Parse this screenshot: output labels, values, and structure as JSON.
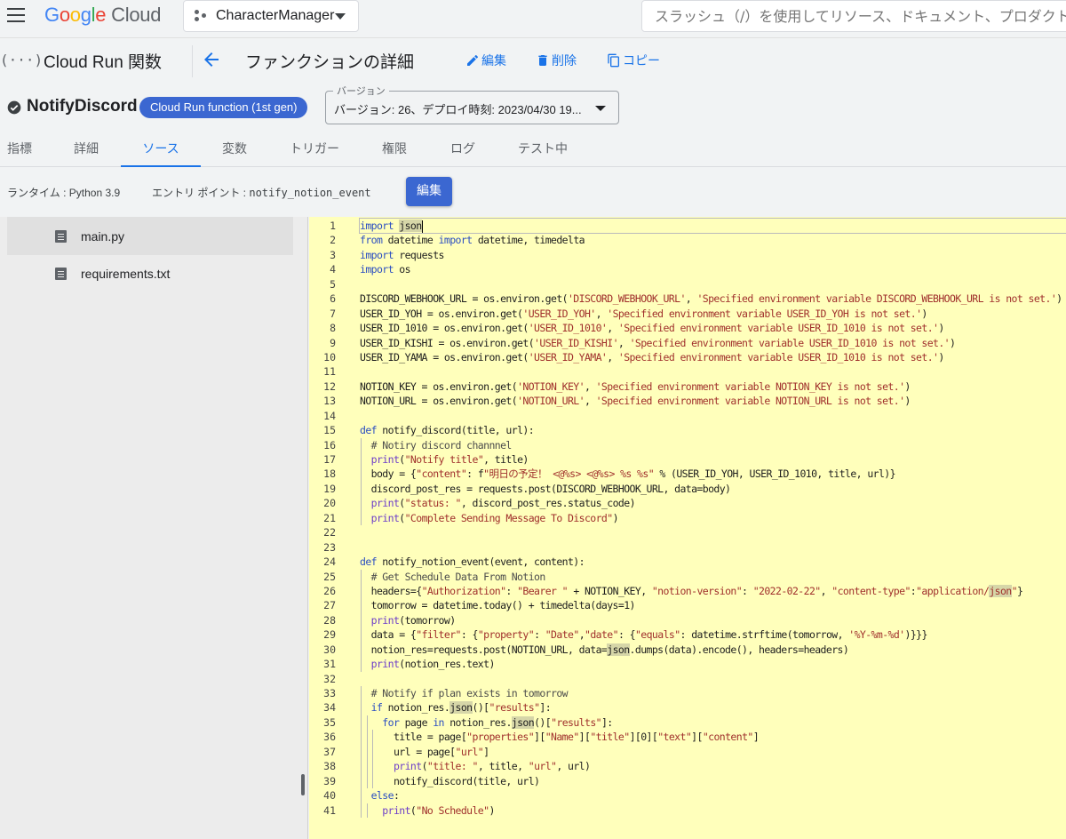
{
  "topbar": {
    "logo_letters": [
      "G",
      "o",
      "o",
      "g",
      "l",
      "e"
    ],
    "logo_suffix": "Cloud",
    "project_name": "CharacterManager",
    "search_placeholder": "スラッシュ（/）を使用してリソース、ドキュメント、プロダクトな"
  },
  "header": {
    "service_icon_text": "(···)",
    "service_name": "Cloud Run 関数",
    "page_title": "ファンクションの詳細",
    "actions": {
      "edit": "編集",
      "delete": "削除",
      "copy": "コピー"
    }
  },
  "function": {
    "name": "NotifyDiscord",
    "generation_badge": "Cloud Run function (1st gen)",
    "version_legend": "バージョン",
    "version_value": "バージョン: 26、デプロイ時刻: 2023/04/30 19..."
  },
  "tabs": [
    {
      "label": "指標"
    },
    {
      "label": "詳細"
    },
    {
      "label": "ソース",
      "active": true
    },
    {
      "label": "変数"
    },
    {
      "label": "トリガー"
    },
    {
      "label": "権限"
    },
    {
      "label": "ログ"
    },
    {
      "label": "テスト中"
    }
  ],
  "source": {
    "runtime_label": "ランタイム : Python 3.9",
    "entry_prefix": "エントリ ポイント : ",
    "entry_point": "notify_notion_event",
    "edit_button": "編集"
  },
  "files": [
    {
      "name": "main.py",
      "selected": true
    },
    {
      "name": "requirements.txt",
      "selected": false
    }
  ],
  "code_lines": [
    "import json",
    "from datetime import datetime, timedelta",
    "import requests",
    "import os",
    "",
    "DISCORD_WEBHOOK_URL = os.environ.get('DISCORD_WEBHOOK_URL', 'Specified environment variable DISCORD_WEBHOOK_URL is not set.')",
    "USER_ID_YOH = os.environ.get('USER_ID_YOH', 'Specified environment variable USER_ID_YOH is not set.')",
    "USER_ID_1010 = os.environ.get('USER_ID_1010', 'Specified environment variable USER_ID_1010 is not set.')",
    "USER_ID_KISHI = os.environ.get('USER_ID_KISHI', 'Specified environment variable USER_ID_1010 is not set.')",
    "USER_ID_YAMA = os.environ.get('USER_ID_YAMA', 'Specified environment variable USER_ID_1010 is not set.')",
    "",
    "NOTION_KEY = os.environ.get('NOTION_KEY', 'Specified environment variable NOTION_KEY is not set.')",
    "NOTION_URL = os.environ.get('NOTION_URL', 'Specified environment variable NOTION_URL is not set.')",
    "",
    "def notify_discord(title, url):",
    "  # Notiry discord channnel",
    "  print(\"Notify title\", title)",
    "  body = {\"content\": f\"明日の予定！ <@%s> <@%s> %s %s\" % (USER_ID_YOH, USER_ID_1010, title, url)}",
    "  discord_post_res = requests.post(DISCORD_WEBHOOK_URL, data=body)",
    "  print(\"status: \", discord_post_res.status_code)",
    "  print(\"Complete Sending Message To Discord\")",
    "",
    "",
    "def notify_notion_event(event, content):",
    "  # Get Schedule Data From Notion",
    "  headers={\"Authorization\": \"Bearer \" + NOTION_KEY, \"notion-version\": \"2022-02-22\", \"content-type\":\"application/json\"}",
    "  tomorrow = datetime.today() + timedelta(days=1)",
    "  print(tomorrow)",
    "  data = {\"filter\": {\"property\": \"Date\",\"date\": {\"equals\": datetime.strftime(tomorrow, '%Y-%m-%d')}}}",
    "  notion_res=requests.post(NOTION_URL, data=json.dumps(data).encode(), headers=headers)",
    "  print(notion_res.text)",
    "",
    "  # Notify if plan exists in tomorrow",
    "  if notion_res.json()[\"results\"]:",
    "    for page in notion_res.json()[\"results\"]:",
    "      title = page[\"properties\"][\"Name\"][\"title\"][0][\"text\"][\"content\"]",
    "      url = page[\"url\"]",
    "      print(\"title: \", title, \"url\", url)",
    "      notify_discord(title, url)",
    "  else:",
    "    print(\"No Schedule\")"
  ],
  "highlight_word": "json",
  "colors": {
    "accent": "#1a73e8",
    "badge": "#3b67d1",
    "editor_bg": "#ffffbb"
  }
}
